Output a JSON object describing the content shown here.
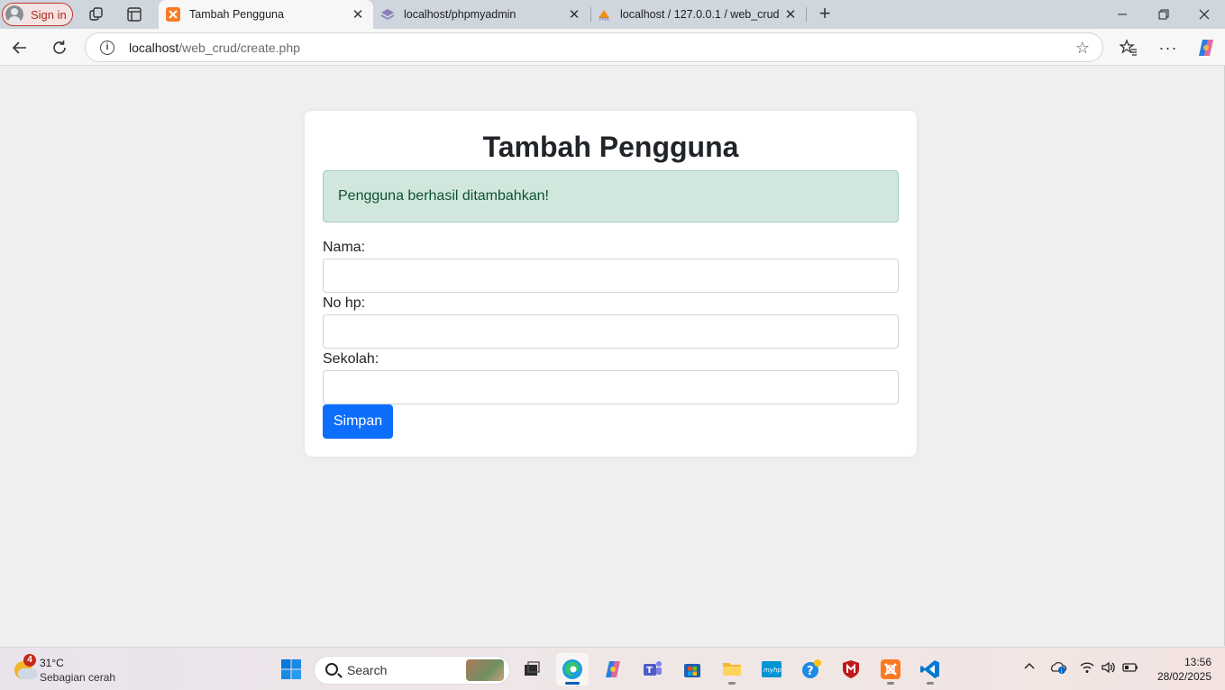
{
  "browser": {
    "signin_label": "Sign in",
    "tabs": [
      {
        "title": "Tambah Pengguna",
        "active": true
      },
      {
        "title": "localhost/phpmyadmin",
        "active": false
      },
      {
        "title": "localhost / 127.0.0.1 / web_crud /",
        "active": false
      }
    ],
    "url_host": "localhost",
    "url_path": "/web_crud/create.php"
  },
  "page": {
    "heading": "Tambah Pengguna",
    "alert_message": "Pengguna berhasil ditambahkan!",
    "fields": [
      {
        "label": "Nama:",
        "value": ""
      },
      {
        "label": "No hp:",
        "value": ""
      },
      {
        "label": "Sekolah:",
        "value": ""
      }
    ],
    "submit_label": "Simpan",
    "colors": {
      "primary": "#0d6efd",
      "alert_bg": "#d1e7dd",
      "alert_text": "#0f5132"
    }
  },
  "taskbar": {
    "weather": {
      "badge": "4",
      "temperature": "31°C",
      "condition": "Sebagian cerah"
    },
    "search_placeholder": "Search",
    "clock_time": "13:56",
    "clock_date": "28/02/2025"
  }
}
